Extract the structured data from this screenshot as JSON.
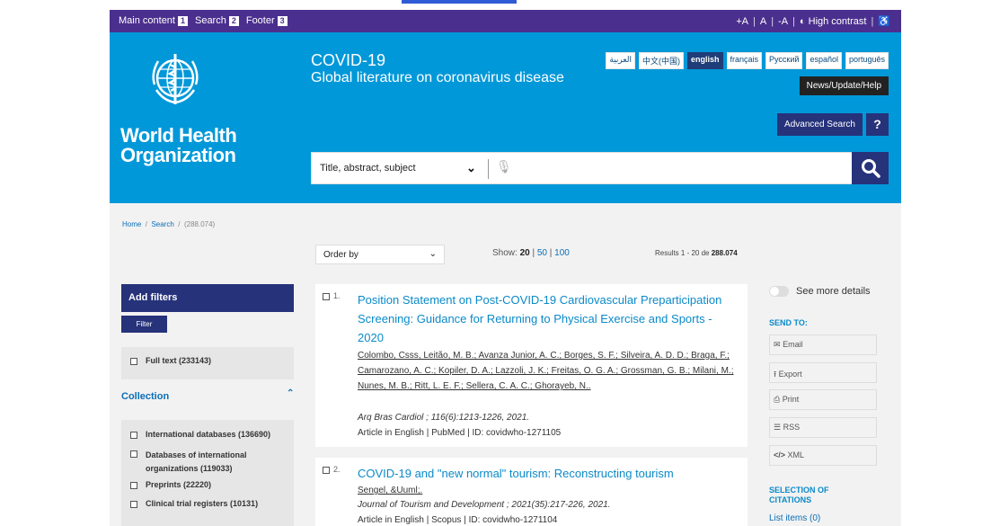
{
  "topbar": {
    "main_content": "Main content",
    "main_content_key": "1",
    "search": "Search",
    "search_key": "2",
    "footer": "Footer",
    "footer_key": "3",
    "font_plus": "+A",
    "font_normal": "A",
    "font_minus": "-A",
    "high_contrast": "High contrast"
  },
  "brand": {
    "line1": "World Health",
    "line2": "Organization"
  },
  "header": {
    "title": "COVID-19",
    "subtitle": "Global literature on coronavirus disease"
  },
  "languages": [
    "العربية",
    "中文(中国)",
    "english",
    "français",
    "Русский",
    "español",
    "português"
  ],
  "news_button": "News/Update/Help",
  "advanced_search": "Advanced Search",
  "help_button": "?",
  "search": {
    "type": "Title, abstract, subject",
    "value": ""
  },
  "breadcrumb": {
    "home": "Home",
    "search": "Search",
    "count": "(288.074)"
  },
  "order_by": "Order by",
  "show": {
    "label": "Show:",
    "current": "20",
    "opt2": "50",
    "opt3": "100"
  },
  "results": {
    "prefix": "Results 1 - 20 de",
    "total": "288.074"
  },
  "filters": {
    "add": "Add filters",
    "filter_button": "Filter",
    "full_text": "Full text (233143)",
    "collection_title": "Collection",
    "collection": [
      "International databases (136690)",
      "Databases of international organizations (119033)",
      "Preprints (22220)",
      "Clinical trial registers (10131)"
    ]
  },
  "results_list": [
    {
      "num": "1.",
      "title": "Position Statement on Post-COVID-19 Cardiovascular Preparticipation Screening: Guidance for Returning to Physical Exercise and Sports - 2020",
      "authors": "Colombo, Csss, Leitão, M. B.; Avanza Junior, A. C.; Borges, S. F.; Silveira, A. D. D.; Braga, F.; Camarozano, A. C.; Kopiler, D. A.; Lazzoli, J. K.; Freitas, O. G. A.; Grossman, G. B.; Milani, M.; Nunes, M. B.; Ritt, L. E. F.; Sellera, C. A. C.; Ghorayeb, N..",
      "journal": "Arq Bras Cardiol ; 116(6):1213-1226, 2021.",
      "meta": "Article in English | PubMed | ID: covidwho-1271105"
    },
    {
      "num": "2.",
      "title": "COVID-19 and \"new normal\" tourism: Reconstructing tourism",
      "authors": "Sengel, &Uuml;.",
      "journal": "Journal of Tourism and Development ; 2021(35):217-226, 2021.",
      "meta": "Article in English | Scopus | ID: covidwho-1271104"
    }
  ],
  "sidebar": {
    "see_more": "See more details",
    "send_to": "SEND TO:",
    "email": "Email",
    "export": "Export",
    "print": "Print",
    "rss": "RSS",
    "xml": "XML",
    "selection": "SELECTION OF CITATIONS",
    "list_items": "List items (0)"
  },
  "colors": {
    "accent": "#0198d9",
    "topbar": "#4b2f8e",
    "button": "#26327a",
    "link": "#0a8ac9"
  }
}
